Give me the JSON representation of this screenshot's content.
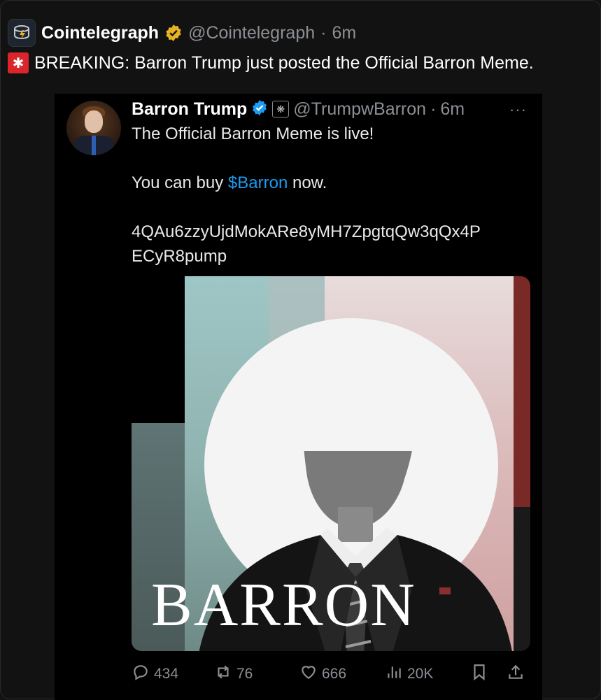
{
  "outer_tweet": {
    "author_name": "Cointelegraph",
    "handle": "@Cointelegraph",
    "separator": "·",
    "time": "6m",
    "text": "BREAKING: Barron Trump just posted the Official Barron Meme."
  },
  "quoted_tweet": {
    "author_name": "Barron Trump",
    "handle": "@TrumpwBarron",
    "separator": "·",
    "time": "6m",
    "line1": "The Official Barron Meme is live!",
    "line2_prefix": "You can buy ",
    "cashtag": "$Barron",
    "line2_suffix": " now.",
    "address_line1": "4QAu6zzyUjdMokARe8yMH7ZpgtqQw3qQx4P",
    "address_line2": "ECyR8pump",
    "media_text": "BARRON",
    "more": "···"
  },
  "actions": {
    "replies": "434",
    "reposts": "76",
    "likes": "666",
    "views": "20K"
  },
  "colors": {
    "accent_link": "#1d9bf0",
    "verified_gold": "#e7b324",
    "verified_blue": "#1d9bf0",
    "siren_red": "#d9252b"
  },
  "icons": [
    "coin-logo-icon",
    "verified-gold-icon",
    "siren-icon",
    "verified-blue-icon",
    "org-badge-icon",
    "more-icon",
    "reply-icon",
    "repost-icon",
    "like-icon",
    "views-icon",
    "bookmark-icon",
    "share-icon"
  ]
}
